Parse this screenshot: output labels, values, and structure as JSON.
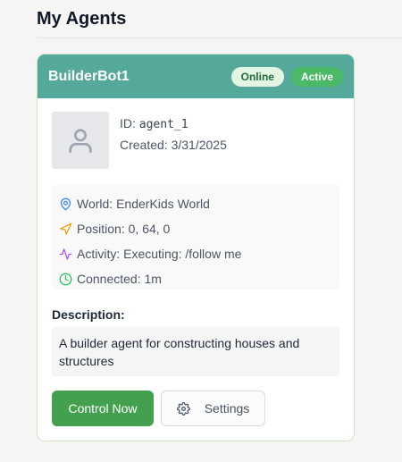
{
  "page": {
    "title": "My Agents"
  },
  "agent": {
    "name": "BuilderBot1",
    "status_badge": "Online",
    "state_badge": "Active",
    "id_label": "ID:",
    "id_value": "agent_1",
    "created_label": "Created:",
    "created_value": "3/31/2025",
    "avatar_icon": "user-icon"
  },
  "info": {
    "world": {
      "icon": "map-pin-icon",
      "text": "World: EnderKids World",
      "color": "#3b82f6"
    },
    "position": {
      "icon": "navigation-icon",
      "text": "Position: 0, 64, 0",
      "color": "#f59e0b"
    },
    "activity": {
      "icon": "activity-icon",
      "text": "Activity: Executing: /follow me",
      "color": "#a855f7"
    },
    "connected": {
      "icon": "clock-icon",
      "text": "Connected: 1m",
      "color": "#22c55e"
    }
  },
  "description": {
    "label": "Description:",
    "text": "A builder agent for constructing houses and structures"
  },
  "actions": {
    "control_label": "Control Now",
    "settings_label": "Settings",
    "settings_icon": "gear-icon"
  },
  "colors": {
    "header": "#55a99b",
    "primary_button": "#43a04e",
    "online_badge_bg": "#e4f5e3",
    "active_badge_bg": "#4bb966"
  }
}
